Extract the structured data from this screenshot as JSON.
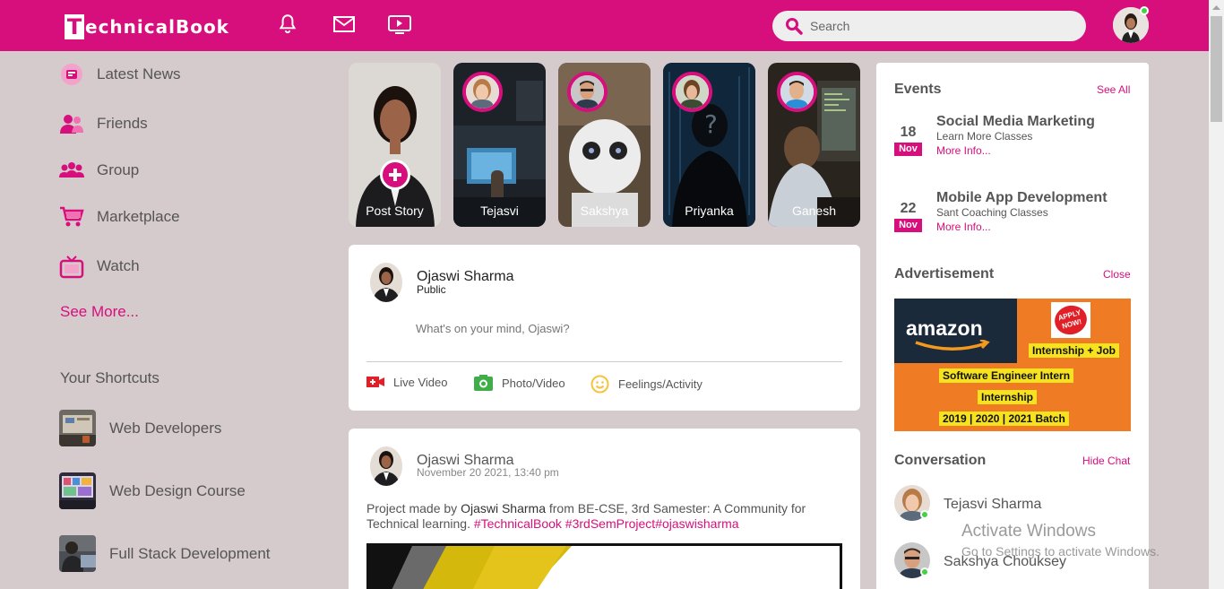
{
  "app": {
    "logo_first": "T",
    "logo_rest": "echnicalBook",
    "accent": "#d70f7c"
  },
  "nav": {
    "icons": [
      "bell-icon",
      "mail-icon",
      "video-icon"
    ],
    "search_placeholder": "Search"
  },
  "sidebar": {
    "items": [
      {
        "label": "Latest News",
        "icon": "news-icon"
      },
      {
        "label": "Friends",
        "icon": "friends-icon"
      },
      {
        "label": "Group",
        "icon": "group-icon"
      },
      {
        "label": "Marketplace",
        "icon": "cart-icon"
      },
      {
        "label": "Watch",
        "icon": "tv-icon"
      }
    ],
    "see_more": "See More...",
    "shortcuts_title": "Your Shortcuts",
    "shortcuts": [
      {
        "label": "Web Developers"
      },
      {
        "label": "Web Design Course"
      },
      {
        "label": "Full Stack Development"
      }
    ]
  },
  "stories": [
    {
      "name": "Post Story"
    },
    {
      "name": "Tejasvi"
    },
    {
      "name": "Sakshya"
    },
    {
      "name": "Priyanka"
    },
    {
      "name": "Ganesh"
    }
  ],
  "composer": {
    "user_name": "Ojaswi Sharma",
    "privacy": "Public",
    "placeholder": "What's on your mind, Ojaswi?",
    "actions": [
      {
        "label": "Live Video",
        "icon": "live-video-icon"
      },
      {
        "label": "Photo/Video",
        "icon": "photo-icon"
      },
      {
        "label": "Feelings/Activity",
        "icon": "smiley-icon"
      }
    ]
  },
  "post": {
    "user_name": "Ojaswi Sharma",
    "timestamp": "November 20 2021, 13:40 pm",
    "text_before": "Project made by ",
    "text_author": "Ojaswi Sharma",
    "text_after": " from BE-CSE, 3rd Samester: A Community for Technical learning. ",
    "hashtags": "#TechnicalBook #3rdSemProject#ojaswisharma"
  },
  "events": {
    "title": "Events",
    "see_all": "See All",
    "items": [
      {
        "day": "18",
        "month": "Nov",
        "title": "Social Media Marketing",
        "subtitle": "Learn More Classes",
        "more": "More Info..."
      },
      {
        "day": "22",
        "month": "Nov",
        "title": "Mobile App Development",
        "subtitle": "Sant Coaching Classes",
        "more": "More Info..."
      }
    ]
  },
  "advertisement": {
    "title": "Advertisement",
    "close": "Close",
    "brand": "amazon",
    "badge": "APPLY NOW!",
    "line1": "Internship + Job",
    "line2": "Software Engineer Intern",
    "line3": "Internship",
    "line4": "2019 | 2020 | 2021 Batch"
  },
  "conversation": {
    "title": "Conversation",
    "hide": "Hide Chat",
    "contacts": [
      {
        "name": "Tejasvi Sharma"
      },
      {
        "name": "Sakshya Chouksey"
      }
    ]
  },
  "os_watermark": {
    "line1": "Activate Windows",
    "line2": "Go to Settings to activate Windows."
  }
}
